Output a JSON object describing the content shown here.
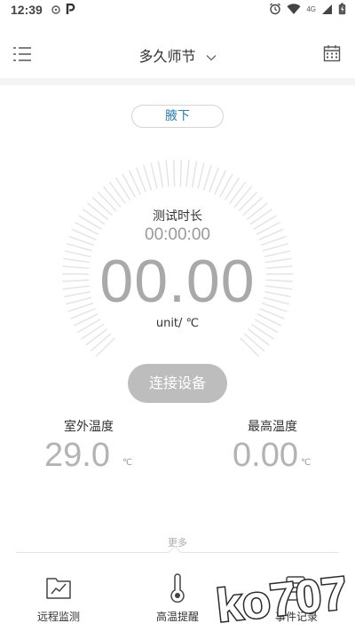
{
  "status_bar": {
    "time": "12:39",
    "network": "4G"
  },
  "header": {
    "title": "多久师节"
  },
  "position": {
    "label": "腋下"
  },
  "gauge": {
    "title": "测试时长",
    "timer": "00:00:00",
    "value": "00.00",
    "unit": "unit/ ℃"
  },
  "connect_button": "连接设备",
  "outdoor": {
    "label": "室外温度",
    "value": "29.0",
    "unit": "℃"
  },
  "max_temp": {
    "label": "最高温度",
    "value": "0.00",
    "unit": "℃"
  },
  "more_label": "更多",
  "bottom_nav": [
    {
      "label": "远程监测",
      "icon": "monitor-chart-icon"
    },
    {
      "label": "高温提醒",
      "icon": "thermometer-icon"
    },
    {
      "label": "事件记录",
      "icon": "record-document-icon"
    }
  ],
  "watermark": "ko707",
  "colors": {
    "accent_blue": "#2a7bb7",
    "button_gray": "#bdbdbd",
    "value_gray": "#a9a9a9"
  }
}
